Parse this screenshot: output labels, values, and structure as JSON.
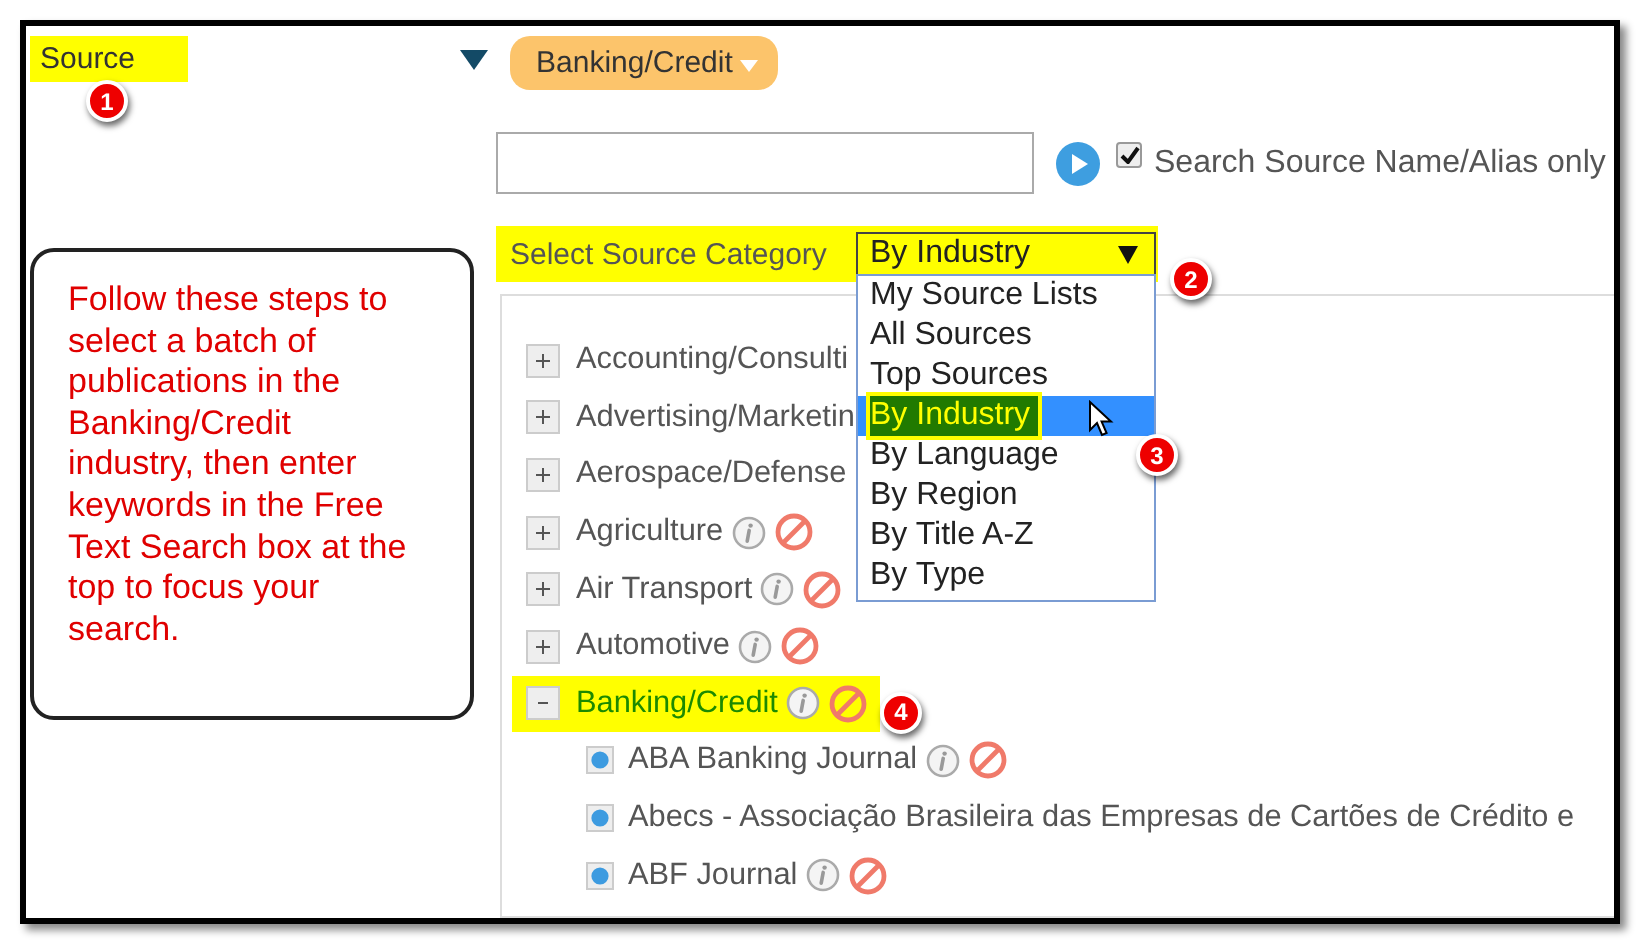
{
  "source_panel": {
    "title": "Source",
    "highlighted": true,
    "expanded": true,
    "badge": "1"
  },
  "callout": {
    "text": "Follow these steps to select a batch of publications in the Banking/Credit industry, then enter keywords in the Free Text Search box at the top to focus your search."
  },
  "selected_filter": {
    "label": "Banking/Credit"
  },
  "search": {
    "checkbox_label": "Search Source Name/Alias only",
    "checked": true
  },
  "category_select": {
    "label": "Select Source Category",
    "value": "By Industry",
    "highlighted": true,
    "badge": "2",
    "option_badge": "3",
    "options": [
      {
        "label": "My Source Lists",
        "selected": false,
        "highlighted": false
      },
      {
        "label": "All Sources",
        "selected": false,
        "highlighted": false
      },
      {
        "label": "Top Sources",
        "selected": false,
        "highlighted": false
      },
      {
        "label": "By Industry",
        "selected": true,
        "highlighted": true
      },
      {
        "label": "By Language",
        "selected": false,
        "highlighted": false
      },
      {
        "label": "By Region",
        "selected": false,
        "highlighted": false
      },
      {
        "label": "By Title A-Z",
        "selected": false,
        "highlighted": false
      },
      {
        "label": "By Type",
        "selected": false,
        "highlighted": false
      }
    ]
  },
  "tree": [
    {
      "label": "Accounting/Consulti",
      "kind": "plain",
      "expanded": false,
      "highlighted": false
    },
    {
      "label": "Advertising/Marketin",
      "kind": "plain",
      "expanded": false,
      "highlighted": false
    },
    {
      "label": "Aerospace/Defense",
      "kind": "plain",
      "expanded": false,
      "highlighted": false
    },
    {
      "label": "Agriculture",
      "kind": "actions",
      "expanded": false,
      "highlighted": false
    },
    {
      "label": "Air Transport",
      "kind": "actions",
      "expanded": false,
      "highlighted": false
    },
    {
      "label": "Automotive",
      "kind": "actions",
      "expanded": false,
      "highlighted": false
    },
    {
      "label": "Banking/Credit",
      "kind": "actions",
      "expanded": true,
      "highlighted": true,
      "badge": "4",
      "children": [
        {
          "label": "ABA Banking Journal",
          "kind": "actions"
        },
        {
          "label": "Abecs - Associação Brasileira das Empresas de Cartões de Crédito e",
          "kind": "plain"
        },
        {
          "label": "ABF Journal",
          "kind": "actions"
        }
      ]
    }
  ]
}
